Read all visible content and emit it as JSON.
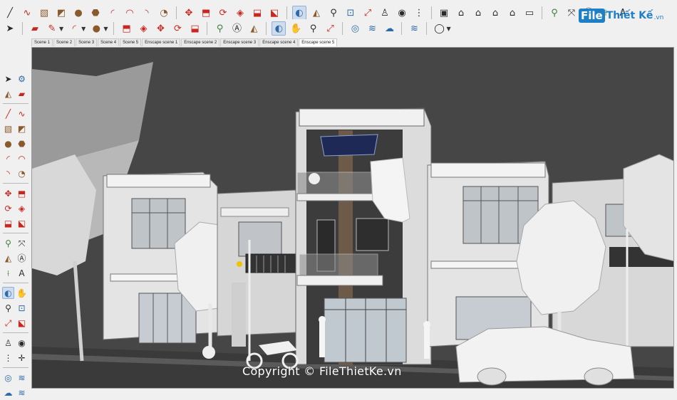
{
  "toolbar": {
    "row1": [
      "line-tool",
      "freehand-tool",
      "rectangle-tool",
      "rotated-rectangle-tool",
      "circle-tool",
      "polygon-tool",
      "arc-tool",
      "two-point-arc-tool",
      "three-point-arc-tool",
      "pie-tool",
      "move-tool",
      "push-pull-tool",
      "rotate-tool",
      "follow-me-tool",
      "scale-tool",
      "offset-tool",
      "section-plane-tool",
      "protractor-tool",
      "zoom-tool",
      "zoom-window-tool",
      "zoom-extents-tool",
      "position-camera-tool",
      "look-around-tool",
      "walk-tool",
      "component-tool",
      "iso-view",
      "top-view",
      "front-view",
      "right-view",
      "back-view",
      "tape-measure-tool",
      "dimension-tool",
      "text-tool",
      "axes-tool",
      "3d-text-tool"
    ],
    "row2": [
      "select-tool",
      "eraser-tool",
      "line-tool",
      "arc-tool",
      "shape-tool",
      "push-pull-tool",
      "move-tool",
      "rotate-tool",
      "scale-tool",
      "tape-measure-tool",
      "text-tool",
      "paint-bucket-tool",
      "orbit-tool",
      "pan-tool",
      "zoom-tool",
      "zoom-extents-tool",
      "section-tool",
      "shadows-tool",
      "fog-tool",
      "styles-tool",
      "account-tool"
    ]
  },
  "scenes": [
    "Scene 1",
    "Scene 2",
    "Scene 3",
    "Scene 4",
    "Scene 5",
    "Enscape scene 1",
    "Enscape scene 2",
    "Enscape scene 3",
    "Enscape scene 4",
    "Enscape scene 5"
  ],
  "active_scene": "Enscape scene 5",
  "logo": {
    "file": "File",
    "rest": "Thiết Kế",
    "domain": ".vn"
  },
  "watermark": "Copyright © FileThietKe.vn",
  "colors": {
    "sky": "#4a4a4a",
    "building": "#e6e6e6",
    "accent_brand": "#1e7fc6"
  }
}
